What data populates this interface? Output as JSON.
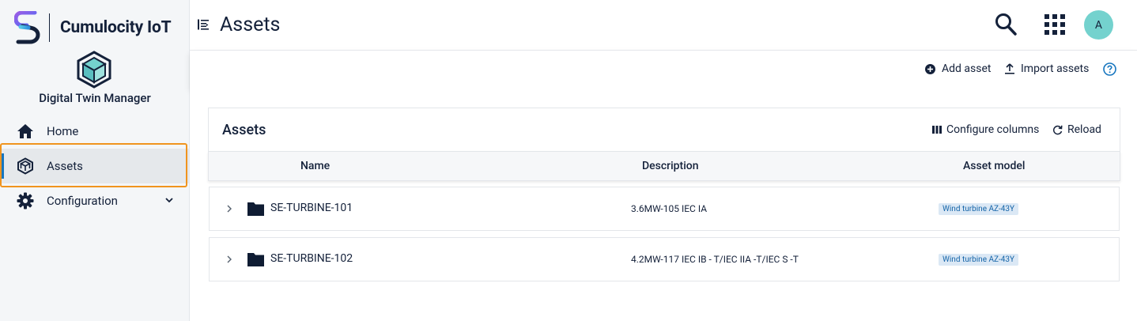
{
  "brand": {
    "name": "Cumulocity IoT"
  },
  "app": {
    "name": "Digital Twin Manager"
  },
  "nav": {
    "items": [
      {
        "label": "Home",
        "icon": "home-icon"
      },
      {
        "label": "Assets",
        "icon": "cube-icon",
        "active": true
      },
      {
        "label": "Configuration",
        "icon": "gear-icon",
        "expandable": true
      }
    ]
  },
  "header": {
    "title": "Assets",
    "avatar_initial": "A",
    "icons": [
      "sidebar-toggle-icon",
      "search-icon",
      "apps-grid-icon"
    ]
  },
  "actionbar": {
    "add_asset": "Add asset",
    "import_assets": "Import assets",
    "help_icon": "help-circle-icon"
  },
  "card": {
    "title": "Assets",
    "configure_columns": "Configure columns",
    "reload": "Reload"
  },
  "table": {
    "columns": [
      "Name",
      "Description",
      "Asset model"
    ],
    "rows": [
      {
        "name": "SE-TURBINE-101",
        "description": "3.6MW-105 IEC IA",
        "asset_model": "Wind turbine AZ-43Y"
      },
      {
        "name": "SE-TURBINE-102",
        "description": "4.2MW-117 IEC IB - T/IEC IIA -T/IEC S -T",
        "asset_model": "Wind turbine AZ-43Y"
      }
    ]
  },
  "colors": {
    "accent": "#1776bf",
    "highlight": "#f0941e",
    "avatar": "#74d2ce",
    "badge_bg": "#dbe8f5",
    "text": "#14213a"
  }
}
